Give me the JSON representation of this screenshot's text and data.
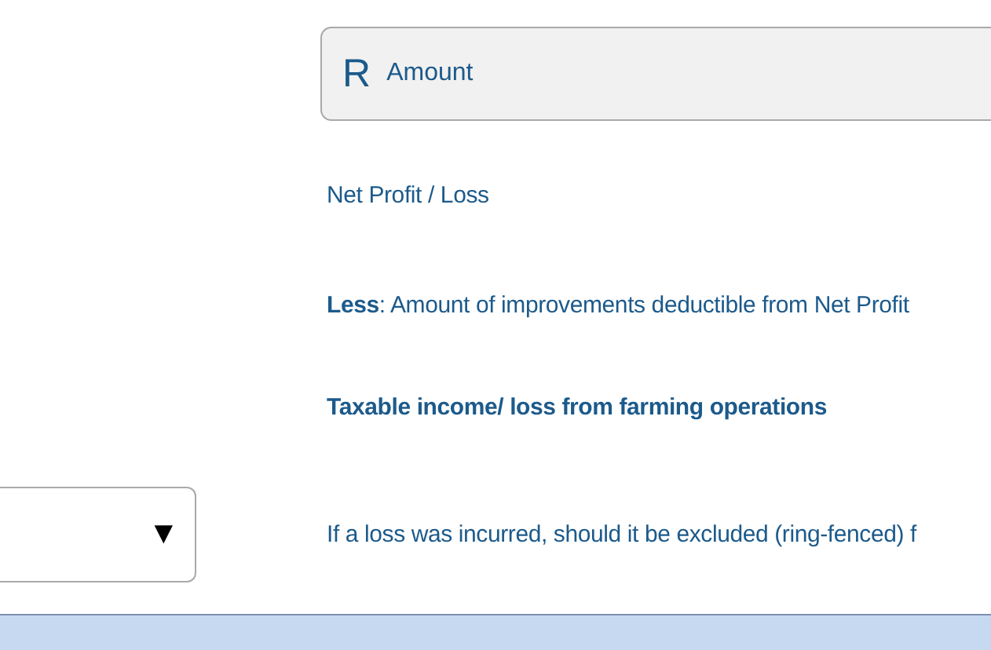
{
  "amount_header": {
    "currency_symbol": "R",
    "label": "Amount"
  },
  "rows": [
    {
      "kind": "plain",
      "label": "Net Profit / Loss"
    },
    {
      "kind": "plain",
      "label": "**Less**: Amount of improvements deductible from Net Profit"
    },
    {
      "kind": "bold",
      "label": "Taxable income/ loss from farming operations"
    },
    {
      "kind": "select",
      "label": "If a loss was incurred, should it be excluded (ring-fenced) f",
      "dropdown": {
        "arrow": "▼"
      }
    }
  ]
}
